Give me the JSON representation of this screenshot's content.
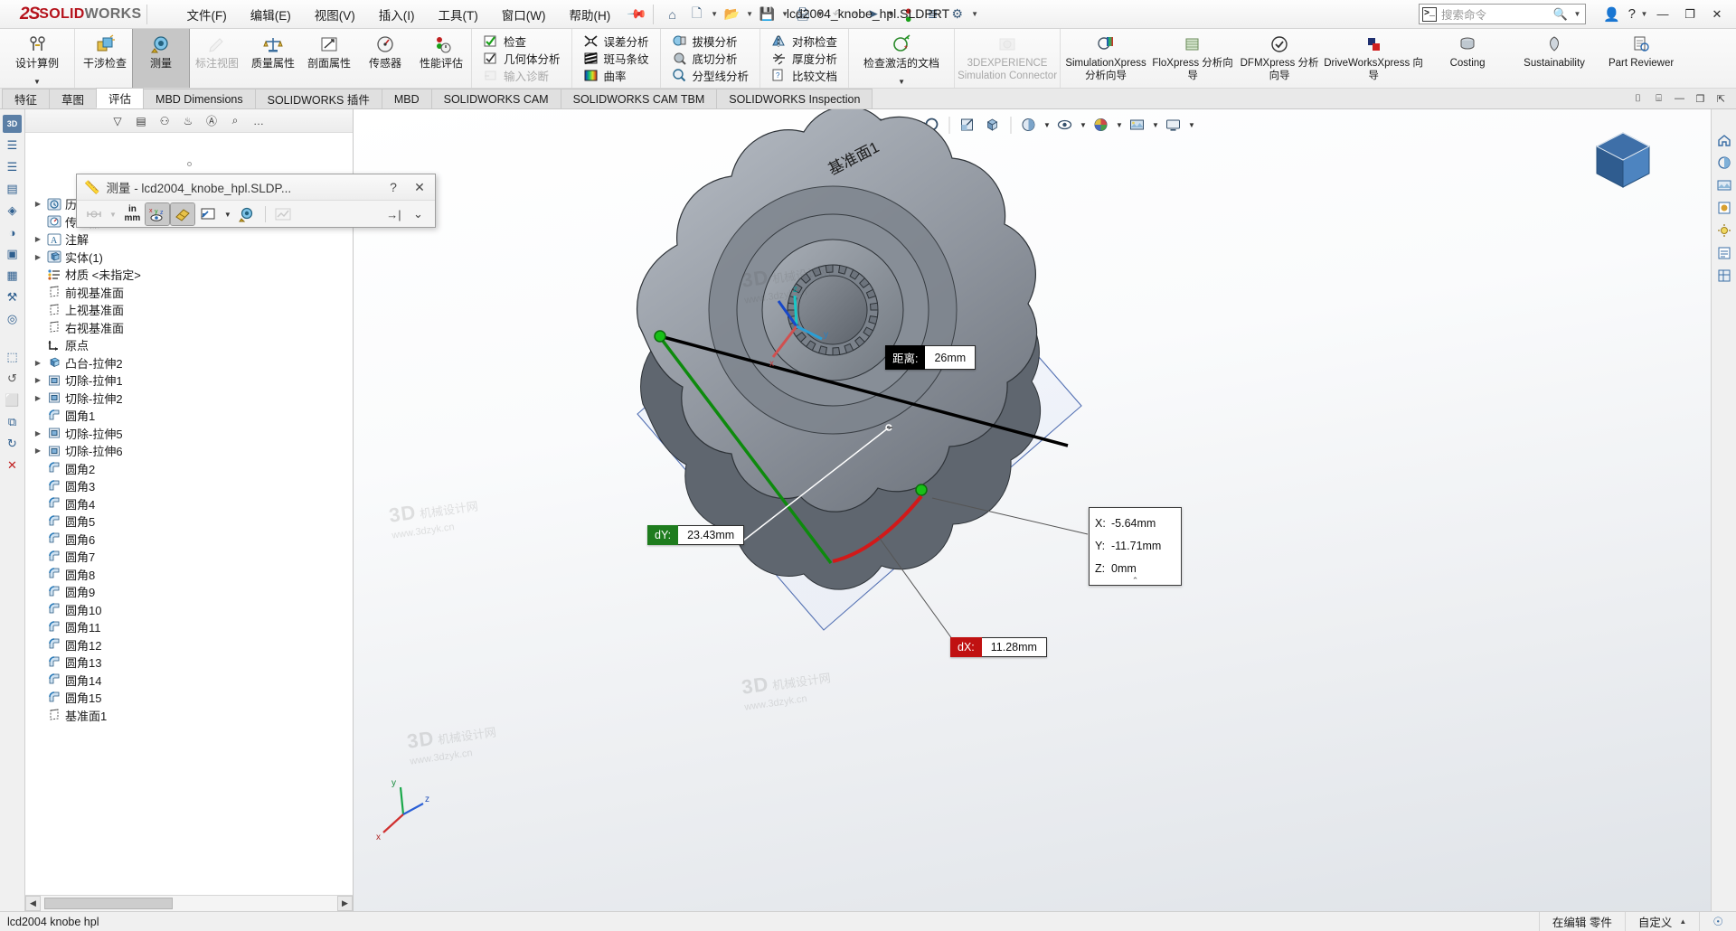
{
  "titlebar": {
    "brand_ds": "2S",
    "brand_solid": "SOLID",
    "brand_works": "WORKS",
    "document_title": "lcd2004_knobe_hpl.SLDPRT",
    "menus": [
      {
        "label": "文件(F)"
      },
      {
        "label": "编辑(E)"
      },
      {
        "label": "视图(V)"
      },
      {
        "label": "插入(I)"
      },
      {
        "label": "工具(T)"
      },
      {
        "label": "窗口(W)"
      },
      {
        "label": "帮助(H)"
      }
    ],
    "pin_icon": "pushpin-icon",
    "quick_access": [
      {
        "name": "home-icon",
        "glyph": "⌂",
        "caret": false
      },
      {
        "name": "new-document-icon",
        "glyph": "὜B",
        "caret": true
      },
      {
        "name": "open-folder-icon",
        "glyph": "Ὄ2",
        "caret": true
      },
      {
        "name": "save-icon",
        "glyph": "ὋE",
        "caret": true
      },
      {
        "name": "print-icon",
        "glyph": "὚8",
        "caret": true
      },
      {
        "name": "undo-icon",
        "glyph": "↶",
        "caret": true,
        "disabled": true
      },
      {
        "name": "select-cursor-icon",
        "glyph": "➤",
        "caret": true
      },
      {
        "name": "rebuild-traffic-light-icon",
        "glyph": "●",
        "caret": false
      },
      {
        "name": "options-list-icon",
        "glyph": "≣",
        "caret": false
      },
      {
        "name": "settings-gear-icon",
        "glyph": "⚙",
        "caret": true
      }
    ],
    "search_placeholder": "搜索命令",
    "user_icon": "user-account-icon",
    "help_icon": "help-question-icon",
    "window_buttons": {
      "minimize": "—",
      "restore": "❐",
      "close": "✕"
    }
  },
  "ribbon": {
    "groups": [
      {
        "kind": "big",
        "buttons": [
          {
            "label": "设计算例",
            "icon": "design-study-icon",
            "width": "wide",
            "dropdown": true
          }
        ]
      },
      {
        "kind": "big",
        "buttons": [
          {
            "label": "干涉检查",
            "icon": "interference-check-icon"
          },
          {
            "label": "测量",
            "icon": "measure-icon",
            "active": true
          },
          {
            "label": "标注视图",
            "icon": "markup-view-icon",
            "disabled": true
          },
          {
            "label": "质量属性",
            "icon": "mass-properties-icon"
          },
          {
            "label": "剖面属性",
            "icon": "section-properties-icon"
          },
          {
            "label": "传感器",
            "icon": "sensor-icon"
          },
          {
            "label": "性能评估",
            "icon": "performance-evaluation-icon"
          }
        ]
      },
      {
        "kind": "stack",
        "items": [
          {
            "label": "检查",
            "icon": "check-icon"
          },
          {
            "label": "几何体分析",
            "icon": "geometry-analysis-icon"
          },
          {
            "label": "输入诊断",
            "icon": "import-diagnostics-icon",
            "disabled": true
          }
        ]
      },
      {
        "kind": "stack",
        "items": [
          {
            "label": "误差分析",
            "icon": "deviation-analysis-icon"
          },
          {
            "label": "斑马条纹",
            "icon": "zebra-stripes-icon"
          },
          {
            "label": "曲率",
            "icon": "curvature-icon"
          }
        ]
      },
      {
        "kind": "stack",
        "items": [
          {
            "label": "拔模分析",
            "icon": "draft-analysis-icon"
          },
          {
            "label": "底切分析",
            "icon": "undercut-analysis-icon"
          },
          {
            "label": "分型线分析",
            "icon": "parting-line-analysis-icon"
          }
        ]
      },
      {
        "kind": "stack",
        "items": [
          {
            "label": "对称检查",
            "icon": "symmetry-check-icon"
          },
          {
            "label": "厚度分析",
            "icon": "thickness-analysis-icon"
          },
          {
            "label": "比较文档",
            "icon": "compare-documents-icon"
          }
        ]
      },
      {
        "kind": "big",
        "buttons": [
          {
            "label": "检查激活的文档",
            "icon": "check-active-document-icon",
            "width": "xxwide",
            "dropdown": true
          }
        ]
      },
      {
        "kind": "big",
        "buttons": [
          {
            "label": "3DEXPERIENCE Simulation Connector",
            "icon": "3dexperience-simulation-connector-icon",
            "width": "xxwide",
            "disabled": true,
            "english": true
          }
        ]
      },
      {
        "kind": "big",
        "buttons": [
          {
            "label": "SimulationXpress 分析向导",
            "icon": "simulationxpress-icon",
            "width": "xwide",
            "english": true
          },
          {
            "label": "FloXpress 分析向导",
            "icon": "floxpress-icon",
            "width": "xwide",
            "english": true
          },
          {
            "label": "DFMXpress 分析向导",
            "icon": "dfmxpress-icon",
            "width": "xwide",
            "english": true
          },
          {
            "label": "DriveWorksXpress 向导",
            "icon": "driveworksxpress-icon",
            "width": "xxwide",
            "english": true
          },
          {
            "label": "Costing",
            "icon": "costing-icon",
            "width": "xwide",
            "english": true
          },
          {
            "label": "Sustainability",
            "icon": "sustainability-icon",
            "width": "xwide",
            "english": true
          },
          {
            "label": "Part Reviewer",
            "icon": "part-reviewer-icon",
            "width": "xwide",
            "english": true
          }
        ]
      }
    ]
  },
  "tabs": {
    "items": [
      {
        "label": "特征"
      },
      {
        "label": "草图"
      },
      {
        "label": "评估",
        "active": true
      },
      {
        "label": "MBD Dimensions"
      },
      {
        "label": "SOLIDWORKS 插件"
      },
      {
        "label": "MBD"
      },
      {
        "label": "SOLIDWORKS CAM"
      },
      {
        "label": "SOLIDWORKS CAM TBM"
      },
      {
        "label": "SOLIDWORKS Inspection"
      }
    ],
    "right_buttons": [
      {
        "name": "panel-expand-icon",
        "glyph": "⌷"
      },
      {
        "name": "panel-collapse-icon",
        "glyph": "⌸"
      },
      {
        "name": "window-minimize-icon",
        "glyph": "—"
      },
      {
        "name": "window-restore-icon",
        "glyph": "❐"
      },
      {
        "name": "window-close-icon",
        "glyph": "⇱"
      }
    ]
  },
  "left_strip": {
    "items": [
      {
        "name": "3d-views-tab",
        "glyph": "3D"
      },
      {
        "name": "feature-manager-tree-icon",
        "glyph": "☰"
      },
      {
        "name": "property-manager-icon",
        "glyph": "☰"
      },
      {
        "name": "configuration-manager-icon",
        "glyph": "▤"
      },
      {
        "name": "dimxpert-manager-icon",
        "glyph": "◈"
      },
      {
        "name": "display-manager-icon",
        "glyph": "◑"
      },
      {
        "name": "cam-feature-tree-icon",
        "glyph": "▣"
      },
      {
        "name": "cam-operation-tree-icon",
        "glyph": "▦"
      },
      {
        "name": "cam-tools-tree-icon",
        "glyph": "⚒"
      },
      {
        "name": "inspection-manager-icon",
        "glyph": "◎"
      },
      {
        "name": "cam-tree-extra-icon",
        "glyph": "⬚",
        "caret": true
      },
      {
        "name": "history-rollback-icon",
        "glyph": "↺"
      },
      {
        "name": "flyout-tree-icon",
        "glyph": "⬜"
      },
      {
        "name": "filter-tree-icon",
        "glyph": "⧉"
      },
      {
        "name": "refresh-tree-icon",
        "glyph": "↻"
      },
      {
        "name": "close-tree-icon",
        "glyph": "✕"
      }
    ]
  },
  "measure_dialog": {
    "title": "测量 - lcd2004_knobe_hpl.SLDP...",
    "help_glyph": "?",
    "close_glyph": "✕",
    "tools": [
      {
        "name": "arc-condition-icon",
        "glyph": "⋈",
        "disabled": true,
        "caret": true
      },
      {
        "name": "units-precision-icon",
        "label_top": "in",
        "label_bottom": "mm"
      },
      {
        "name": "xyz-projection-icon",
        "glyph": "xyz",
        "active": true
      },
      {
        "name": "projected-on-icon",
        "glyph": "◆",
        "active": true
      },
      {
        "name": "measurement-face-icon",
        "glyph": "◰",
        "caret": true
      },
      {
        "name": "point-to-point-icon",
        "glyph": "◎"
      },
      {
        "name": "history-chart-icon",
        "glyph": "〰",
        "disabled": true
      },
      {
        "name": "pin-dialog-icon",
        "glyph": "→|"
      },
      {
        "name": "expand-dialog-icon",
        "glyph": "⌄"
      }
    ]
  },
  "feature_tree": {
    "toolbar_icons": [
      {
        "name": "tree-filter-icon",
        "glyph": "▽"
      },
      {
        "name": "tree-display-icon",
        "glyph": "▤"
      },
      {
        "name": "tree-history-icon",
        "glyph": "⚇"
      },
      {
        "name": "tree-sensor-icon",
        "glyph": "♨"
      },
      {
        "name": "tree-annotation-icon",
        "glyph": "Ⓐ"
      },
      {
        "name": "tree-search-icon",
        "glyph": "⌕"
      },
      {
        "name": "tree-more-icon",
        "glyph": "…"
      }
    ],
    "items": [
      {
        "label": "历史记录",
        "icon": "history-icon",
        "expandable": true,
        "indent": 0
      },
      {
        "label": "传感器",
        "icon": "sensors-icon",
        "expandable": false,
        "indent": 0
      },
      {
        "label": "注解",
        "icon": "annotations-icon",
        "expandable": true,
        "indent": 0
      },
      {
        "label": "实体(1)",
        "icon": "solid-bodies-icon",
        "expandable": true,
        "indent": 0
      },
      {
        "label": "材质 <未指定>",
        "icon": "material-icon",
        "expandable": false,
        "indent": 0
      },
      {
        "label": "前视基准面",
        "icon": "plane-icon",
        "expandable": false,
        "indent": 0
      },
      {
        "label": "上视基准面",
        "icon": "plane-icon",
        "expandable": false,
        "indent": 0
      },
      {
        "label": "右视基准面",
        "icon": "plane-icon",
        "expandable": false,
        "indent": 0
      },
      {
        "label": "原点",
        "icon": "origin-icon",
        "expandable": false,
        "indent": 0
      },
      {
        "label": "凸台-拉伸2",
        "icon": "boss-extrude-icon",
        "expandable": true,
        "indent": 0
      },
      {
        "label": "切除-拉伸1",
        "icon": "cut-extrude-icon",
        "expandable": true,
        "indent": 0
      },
      {
        "label": "切除-拉伸2",
        "icon": "cut-extrude-icon",
        "expandable": true,
        "indent": 0
      },
      {
        "label": "圆角1",
        "icon": "fillet-icon",
        "expandable": false,
        "indent": 0
      },
      {
        "label": "切除-拉伸5",
        "icon": "cut-extrude-icon",
        "expandable": true,
        "indent": 0
      },
      {
        "label": "切除-拉伸6",
        "icon": "cut-extrude-icon",
        "expandable": true,
        "indent": 0
      },
      {
        "label": "圆角2",
        "icon": "fillet-icon",
        "expandable": false,
        "indent": 0
      },
      {
        "label": "圆角3",
        "icon": "fillet-icon",
        "expandable": false,
        "indent": 0
      },
      {
        "label": "圆角4",
        "icon": "fillet-icon",
        "expandable": false,
        "indent": 0
      },
      {
        "label": "圆角5",
        "icon": "fillet-icon",
        "expandable": false,
        "indent": 0
      },
      {
        "label": "圆角6",
        "icon": "fillet-icon",
        "expandable": false,
        "indent": 0
      },
      {
        "label": "圆角7",
        "icon": "fillet-icon",
        "expandable": false,
        "indent": 0
      },
      {
        "label": "圆角8",
        "icon": "fillet-icon",
        "expandable": false,
        "indent": 0
      },
      {
        "label": "圆角9",
        "icon": "fillet-icon",
        "expandable": false,
        "indent": 0
      },
      {
        "label": "圆角10",
        "icon": "fillet-icon",
        "expandable": false,
        "indent": 0
      },
      {
        "label": "圆角11",
        "icon": "fillet-icon",
        "expandable": false,
        "indent": 0
      },
      {
        "label": "圆角12",
        "icon": "fillet-icon",
        "expandable": false,
        "indent": 0
      },
      {
        "label": "圆角13",
        "icon": "fillet-icon",
        "expandable": false,
        "indent": 0
      },
      {
        "label": "圆角14",
        "icon": "fillet-icon",
        "expandable": false,
        "indent": 0
      },
      {
        "label": "圆角15",
        "icon": "fillet-icon",
        "expandable": false,
        "indent": 0
      },
      {
        "label": "基准面1",
        "icon": "plane-icon",
        "expandable": false,
        "indent": 0
      }
    ],
    "scroll_left_glyph": "◀",
    "scroll_right_glyph": "▶"
  },
  "viewport": {
    "toolbar": [
      {
        "name": "zoom-to-fit-icon",
        "glyph": "⌕",
        "caret": false
      },
      {
        "name": "zoom-to-area-icon",
        "glyph": "⊞",
        "caret": false
      },
      {
        "name": "previous-view-icon",
        "glyph": "↩",
        "caret": false
      },
      {
        "name": "section-view-icon",
        "glyph": "◧",
        "caret": false
      },
      {
        "name": "view-orientation-icon",
        "glyph": "⬚",
        "caret": false
      },
      {
        "name": "display-style-icon",
        "glyph": "◱",
        "caret": true
      },
      {
        "name": "hide-show-items-icon",
        "glyph": "◈",
        "caret": true
      },
      {
        "name": "edit-appearance-icon",
        "glyph": "◕",
        "caret": true
      },
      {
        "name": "apply-scene-icon",
        "glyph": "◍",
        "caret": true
      },
      {
        "name": "view-settings-icon",
        "glyph": "▭",
        "caret": true
      }
    ],
    "plane_label": "基准面1",
    "callouts": [
      {
        "name": "distance-callout",
        "key": "距离:",
        "value": "26mm",
        "color": "black"
      },
      {
        "name": "dy-callout",
        "key": "dY:",
        "value": "23.43mm",
        "color": "green"
      },
      {
        "name": "dx-callout",
        "key": "dX:",
        "value": "11.28mm",
        "color": "red"
      }
    ],
    "xyz_box": {
      "name": "xyz-delta-box",
      "rows": [
        {
          "axis": "X:",
          "value": "-5.64mm"
        },
        {
          "axis": "Y:",
          "value": "-11.71mm"
        },
        {
          "axis": "Z:",
          "value": "0mm"
        }
      ],
      "chevron": "⌃"
    },
    "triad": {
      "x": "x",
      "y": "y",
      "z": "z"
    },
    "watermarks": [
      {
        "text": "3D 机械设计网",
        "sub": "www.3dzyk.cn"
      }
    ]
  },
  "right_rail": {
    "items": [
      {
        "name": "view-home-icon",
        "glyph": "⌂"
      },
      {
        "name": "appearances-icon",
        "glyph": "▤"
      },
      {
        "name": "scenes-icon",
        "glyph": "◱"
      },
      {
        "name": "decals-icon",
        "glyph": "▧"
      },
      {
        "name": "lights-cameras-icon",
        "glyph": "◉"
      },
      {
        "name": "custom-properties-icon",
        "glyph": "≣"
      },
      {
        "name": "design-library-icon",
        "glyph": "▦"
      }
    ]
  },
  "statusbar": {
    "document_name": "lcd2004 knobe hpl",
    "editing_state": "在编辑 零件",
    "custom_label": "自定义",
    "custom_caret": "▲",
    "tray_icon": "solidworks-tray-icon"
  }
}
